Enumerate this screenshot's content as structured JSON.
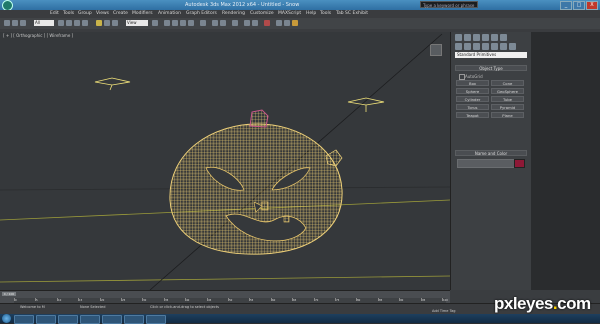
{
  "titlebar": {
    "title": "Autodesk 3ds Max 2012 x64 - Untitled - Snow",
    "search_placeholder": "Type a keyword or phrase"
  },
  "window_buttons": [
    "_",
    "□",
    "X"
  ],
  "menu": [
    "Edit",
    "Tools",
    "Group",
    "Views",
    "Create",
    "Modifiers",
    "Animation",
    "Graph Editors",
    "Rendering",
    "Customize",
    "MAXScript",
    "Help",
    "Tools",
    "Tab SC Exhibit"
  ],
  "toolbar": {
    "selection_filter": "All",
    "reference_coord": "View"
  },
  "viewport": {
    "label": "[ + ] [ Orthographic ] [ Wireframe ]"
  },
  "command_panel": {
    "category_dropdown": "Standard Primitives",
    "object_type_title": "Object Type",
    "autogrid_label": "AutoGrid",
    "buttons": [
      "Box",
      "Cone",
      "Sphere",
      "GeoSphere",
      "Cylinder",
      "Tube",
      "Torus",
      "Pyramid",
      "Teapot",
      "Plane"
    ],
    "name_and_color_title": "Name and Color",
    "name_value": "",
    "object_color": "#8e1836"
  },
  "timeline": {
    "slider_label": "0 / 100",
    "tick_labels": [
      "0",
      "5",
      "10",
      "15",
      "20",
      "25",
      "30",
      "35",
      "40",
      "45",
      "50",
      "55",
      "60",
      "65",
      "70",
      "75",
      "80",
      "85",
      "90",
      "95",
      "100"
    ]
  },
  "status": {
    "left": "None Selected",
    "mid": "Click or click-and-drag to select objects",
    "right": "Add Time Tag",
    "welcome": "Welcome to M"
  },
  "colors": {
    "wireframe": "#f0d27a",
    "wire_top": "#c9578a",
    "helper": "#f2e37a",
    "grid_line": "#9a9a3a"
  },
  "watermark": {
    "prefix": "pxleyes",
    "dot": ".",
    "suffix": "com"
  }
}
